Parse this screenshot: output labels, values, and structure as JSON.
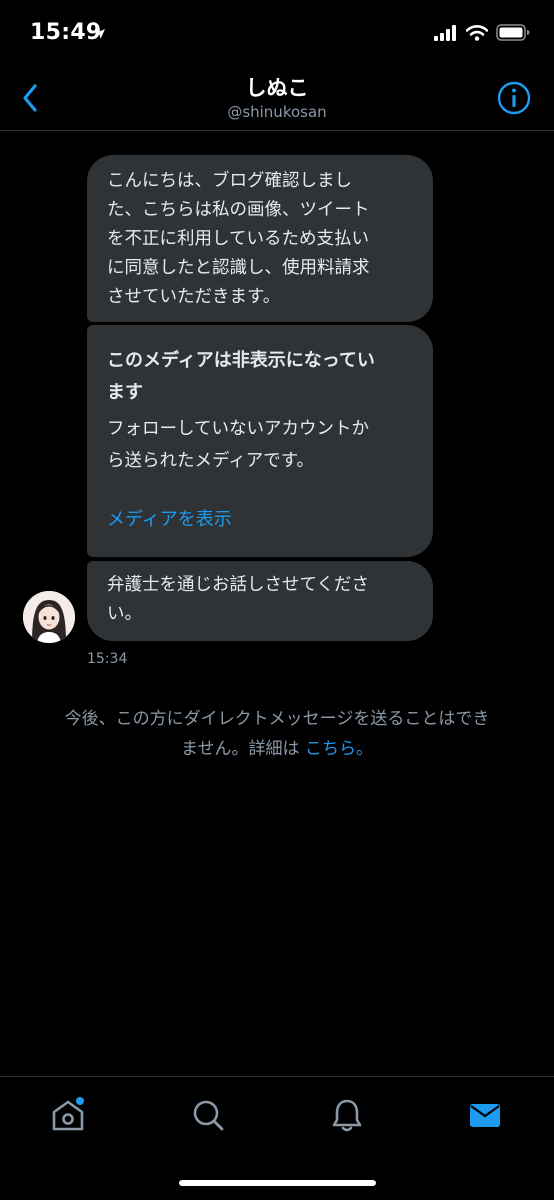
{
  "status_bar": {
    "time": "15:49",
    "icons": [
      "location-arrow-icon",
      "cellular-signal-icon",
      "wifi-icon",
      "battery-icon"
    ]
  },
  "header": {
    "title": "しぬこ",
    "handle": "@shinukosan",
    "back_icon": "chevron-left-icon",
    "info_icon": "info-icon",
    "accent_color": "#1d9bf0"
  },
  "conversation": {
    "messages": [
      {
        "lines": [
          "こんにちは、ブログ確認しまし",
          "た、こちらは私の画像、ツイート",
          "を不正に利用しているため支払い",
          "に同意したと認識し、使用料請求",
          "させていただきます。"
        ]
      },
      {
        "media_title_lines": [
          "このメディアは非表示になってい",
          "ます"
        ],
        "media_desc_lines": [
          "フォローしていないアカウントか",
          "ら送られたメディアです。"
        ],
        "media_link": "メディアを表示"
      },
      {
        "lines": [
          "弁護士を通じお話しさせてくださ",
          "い。"
        ]
      }
    ],
    "timestamp": "15:34",
    "notice": {
      "line1": "今後、この方にダイレクトメッセージを送ることはでき",
      "line2_prefix": "ません。詳細は ",
      "link": "こちら。"
    }
  },
  "tab_bar": {
    "tabs": [
      {
        "icon": "home-icon",
        "has_badge": true,
        "active": false
      },
      {
        "icon": "search-icon",
        "active": false
      },
      {
        "icon": "notifications-bell-icon",
        "active": false
      },
      {
        "icon": "messages-envelope-icon",
        "active": true
      }
    ]
  }
}
